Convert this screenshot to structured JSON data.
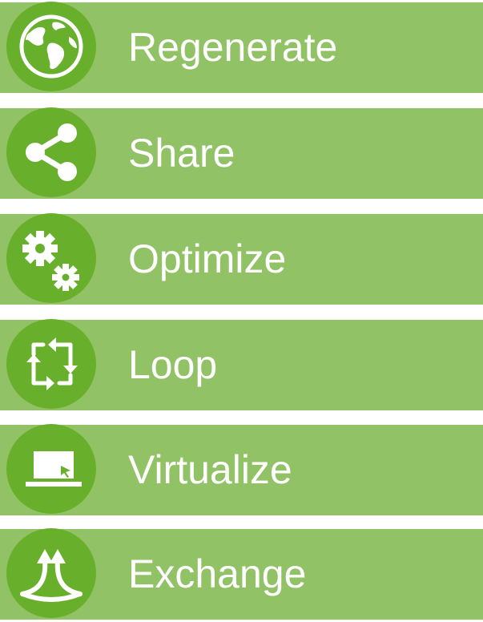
{
  "colors": {
    "band": "#92c266",
    "circle": "#68b02c",
    "text": "#ffffff"
  },
  "items": [
    {
      "label": "Regenerate",
      "icon": "globe-icon"
    },
    {
      "label": "Share",
      "icon": "share-icon"
    },
    {
      "label": "Optimize",
      "icon": "gears-icon"
    },
    {
      "label": "Loop",
      "icon": "loop-icon"
    },
    {
      "label": "Virtualize",
      "icon": "laptop-cursor-icon"
    },
    {
      "label": "Exchange",
      "icon": "exchange-arrows-icon"
    }
  ]
}
